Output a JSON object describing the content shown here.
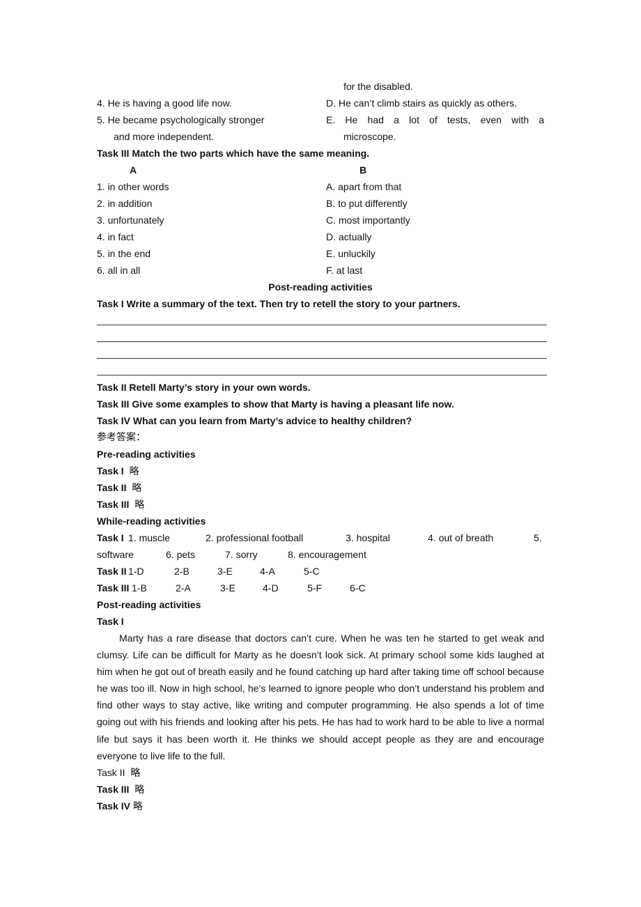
{
  "task2_tail": {
    "rows": [
      {
        "left": "",
        "right_cont": "for the disabled."
      },
      {
        "left": "4. He is having a good life now.",
        "right": "D. He can’t climb stairs as quickly as others."
      },
      {
        "left": "5. He became psychologically stronger",
        "right_words": [
          "E.",
          "He",
          "had",
          "a",
          "lot",
          "of",
          "tests,",
          "even",
          "with",
          "a"
        ]
      },
      {
        "left_cont": "and more independent.",
        "right_cont": "microscope."
      }
    ]
  },
  "task3": {
    "heading": "Task III Match the two parts which have the same meaning.",
    "col_a_header": "A",
    "col_b_header": "B",
    "col_a": [
      "1. in other words",
      "2. in addition",
      "3. unfortunately",
      "4. in fact",
      "5. in the end",
      "6. all in all"
    ],
    "col_b": [
      "A. apart from that",
      "B. to put differently",
      "C. most importantly",
      "D. actually",
      "E. unluckily",
      "F. at last"
    ]
  },
  "post_reading": {
    "heading": "Post-reading activities",
    "task1": "Task I Write a summary of the text. Then try to retell the story to your partners.",
    "blank_lines": 4,
    "task2": "Task II Retell Marty’s story in your own words.",
    "task3": "Task III Give some examples to show that Marty is having a pleasant life now.",
    "task4": "Task IV What can you learn from Marty’s advice to healthy children?"
  },
  "answers": {
    "heading": "参考答案：",
    "pre_reading": {
      "heading": "Pre-reading activities",
      "items": [
        {
          "label": "Task I",
          "value": "略"
        },
        {
          "label": "Task II",
          "value": "略"
        },
        {
          "label": "Task III",
          "value": "略"
        }
      ]
    },
    "while_reading": {
      "heading": "While-reading activities",
      "task1_label": "Task I",
      "task1_line1": [
        "1. muscle",
        "2. professional football",
        "3. hospital",
        "4. out of breath",
        "5."
      ],
      "task1_line2": [
        "software",
        "6. pets",
        "7. sorry",
        "8. encouragement"
      ],
      "task2_label": "Task II",
      "task2_items": [
        "1-D",
        "2-B",
        "3-E",
        "4-A",
        "5-C"
      ],
      "task3_label": "Task III",
      "task3_items": [
        "1-B",
        "2-A",
        "3-E",
        "4-D",
        "5-F",
        "6-C"
      ]
    },
    "post_reading": {
      "heading": "Post-reading activities",
      "task1_label": "Task I",
      "summary": "Marty has a rare disease that doctors can’t cure. When he was ten he started to get weak and clumsy. Life can be difficult for Marty as he doesn’t look sick. At primary school some kids laughed at him when he got out of breath easily and he found catching up hard after taking time off school because he was too ill. Now in high school, he’s learned to ignore people who don’t understand his problem and find other ways to stay active, like writing and computer programming. He also spends a lot of time going out with his friends and looking after his pets. He has had to work hard to be able to live a normal life but says it has been worth it. He thinks we should accept people as they are and encourage everyone to live life to the full.",
      "items": [
        {
          "label": "Task II",
          "value": "略",
          "bold": false
        },
        {
          "label": "Task III",
          "value": "略",
          "bold": true
        },
        {
          "label": "Task IV",
          "value": "略",
          "bold": true
        }
      ]
    }
  }
}
